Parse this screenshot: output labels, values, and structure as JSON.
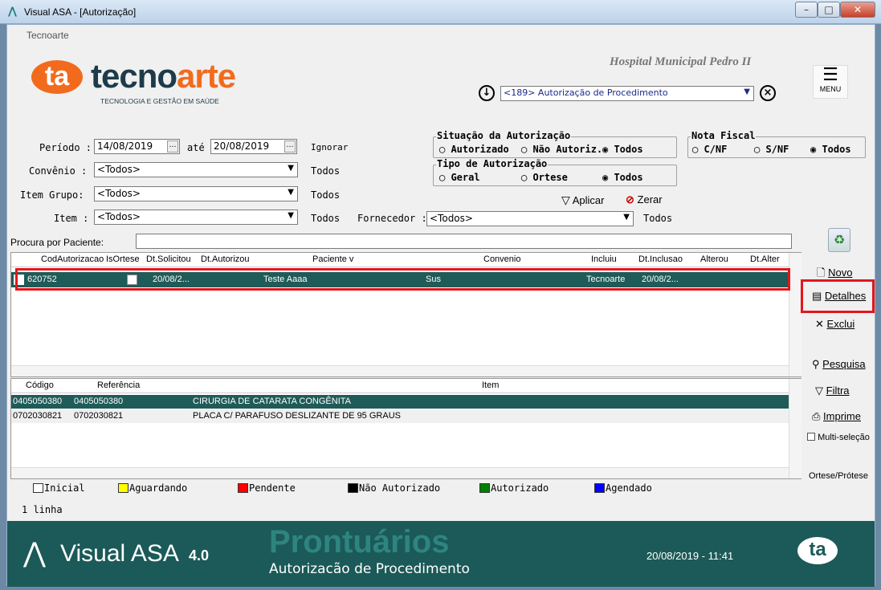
{
  "window": {
    "title": "Visual ASA - [Autorização]",
    "app_icon": "visual-asa-icon",
    "controls": {
      "minimize": "–",
      "maximize": "□",
      "close": "✕"
    }
  },
  "header": {
    "company": "Tecnoarte",
    "logo_mark": "ta",
    "logo_name_1": "tecno",
    "logo_name_2": "arte",
    "logo_tagline": "TECNOLOGIA E GESTÃO EM SAÚDE",
    "hospital": "Hospital Municipal Pedro II",
    "module_select": "<189> Autorização de Procedimento",
    "menu_label": "MENU"
  },
  "filters": {
    "periodo_label": "Período :",
    "periodo_from": "14/08/2019",
    "ate_label": "até",
    "periodo_to": "20/08/2019",
    "ignorar_label": "Ignorar",
    "convenio_label": "Convênio :",
    "convenio_value": "<Todos>",
    "convenio_todos": "Todos",
    "item_grupo_label": "Item Grupo:",
    "item_grupo_value": "<Todos>",
    "item_grupo_todos": "Todos",
    "item_label": "Item :",
    "item_value": "<Todos>",
    "item_todos": "Todos",
    "fornecedor_label": "Fornecedor :",
    "fornecedor_value": "<Todos>",
    "fornecedor_todos": "Todos",
    "paciente_label": "Procura por Paciente:",
    "paciente_value": ""
  },
  "situacao": {
    "title": "Situação da Autorização",
    "options": [
      "Autorizado",
      "Não Autoriz.",
      "Todos"
    ],
    "selected": "Todos"
  },
  "tipo": {
    "title": "Tipo de Autorização",
    "options": [
      "Geral",
      "Ortese",
      "Todos"
    ],
    "selected": "Todos"
  },
  "nota": {
    "title": "Nota Fiscal",
    "options": [
      "C/NF",
      "S/NF",
      "Todos"
    ],
    "selected": "Todos"
  },
  "actions": {
    "aplicar": "Aplicar",
    "zerar": "Zerar"
  },
  "main_grid": {
    "columns": [
      "CodAutorizacao",
      "IsOrtese",
      "Dt.Solicitou",
      "Dt.Autorizou",
      "Paciente v",
      "Convenio",
      "Incluiu",
      "Dt.Inclusao",
      "Alterou",
      "Dt.Alter"
    ],
    "rows": [
      {
        "cod": "620752",
        "dt_solicitou": "20/08/2...",
        "paciente": "Teste Aaaa",
        "convenio": "Sus",
        "incluiu": "Tecnoarte",
        "dt_inclusao": "20/08/2..."
      }
    ]
  },
  "item_grid": {
    "columns": [
      "Código",
      "Referência",
      "Item"
    ],
    "rows": [
      {
        "codigo": "0405050380",
        "referencia": "0405050380",
        "item": "CIRURGIA DE CATARATA CONGÊNITA"
      },
      {
        "codigo": "0702030821",
        "referencia": "0702030821",
        "item": "PLACA C/ PARAFUSO DESLIZANTE DE 95 GRAUS"
      }
    ]
  },
  "side_buttons": {
    "novo": "Novo",
    "detalhes": "Detalhes",
    "exclui": "Exclui",
    "pesquisa": "Pesquisa",
    "filtra": "Filtra",
    "imprime": "Imprime",
    "multi": "Multi-seleção",
    "ortese": "Ortese/Prótese"
  },
  "legend": [
    {
      "label": "Inicial",
      "color": "#ffffff"
    },
    {
      "label": "Aguardando",
      "color": "#ffff00"
    },
    {
      "label": "Pendente",
      "color": "#ff0000"
    },
    {
      "label": "Não Autorizado",
      "color": "#000000"
    },
    {
      "label": "Autorizado",
      "color": "#008000"
    },
    {
      "label": "Agendado",
      "color": "#0000ff"
    }
  ],
  "status": {
    "lines": "1 linha"
  },
  "footer": {
    "brand": "Visual ASA",
    "version": "4.0",
    "product": "Prontuários",
    "subtitle": "Autorizacão de Procedimento",
    "datetime": "20/08/2019 - 11:41",
    "logo_mark": "ta"
  },
  "colors": {
    "accent": "#1b5a58",
    "highlight": "#e3161b",
    "logo_orange": "#f26b1d",
    "logo_teal": "#138c8a"
  }
}
